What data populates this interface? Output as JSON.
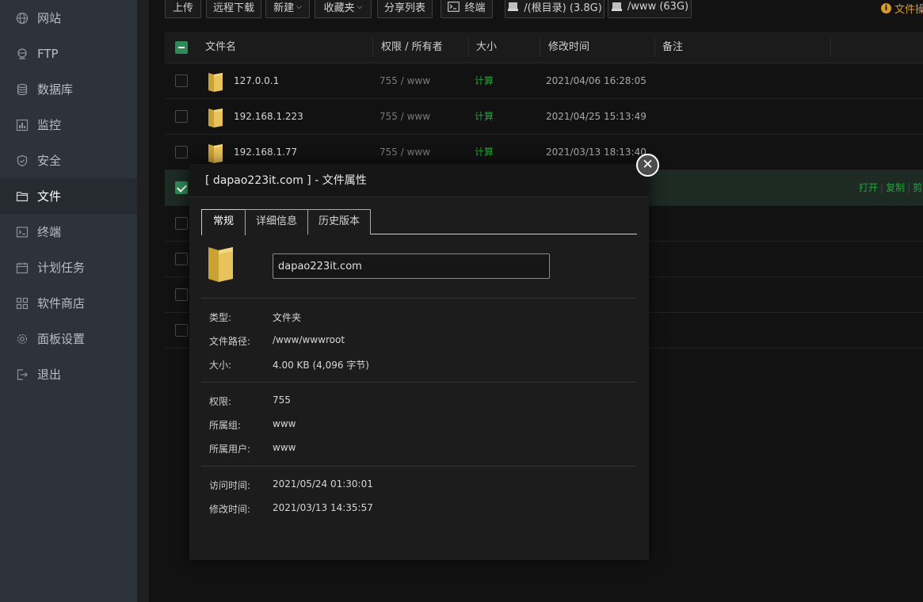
{
  "sidebar": {
    "items": [
      {
        "label": "网站",
        "icon": "globe-icon",
        "active": false
      },
      {
        "label": "FTP",
        "icon": "ftp-icon",
        "active": false
      },
      {
        "label": "数据库",
        "icon": "database-icon",
        "active": false
      },
      {
        "label": "监控",
        "icon": "monitor-icon",
        "active": false
      },
      {
        "label": "安全",
        "icon": "shield-icon",
        "active": false
      },
      {
        "label": "文件",
        "icon": "folder-icon",
        "active": true
      },
      {
        "label": "终端",
        "icon": "terminal-icon",
        "active": false
      },
      {
        "label": "计划任务",
        "icon": "calendar-icon",
        "active": false
      },
      {
        "label": "软件商店",
        "icon": "apps-icon",
        "active": false
      },
      {
        "label": "面板设置",
        "icon": "gear-icon",
        "active": false
      },
      {
        "label": "退出",
        "icon": "logout-icon",
        "active": false
      }
    ]
  },
  "toolbar": {
    "upload": "上传",
    "remote_download": "远程下载",
    "new": "新建",
    "favorites": "收藏夹",
    "share_list": "分享列表",
    "terminal": "终端",
    "disk_root": "/(根目录) (3.8G)",
    "disk_www": "/www (63G)",
    "hint": "文件操"
  },
  "table": {
    "headers": {
      "name": "文件名",
      "perm": "权限 / 所有者",
      "size": "大小",
      "mtime": "修改时间",
      "note": "备注"
    },
    "rows": [
      {
        "name": "127.0.0.1",
        "perm": "755 / www",
        "size": "计算",
        "mtime": "2021/04/06 16:28:05"
      },
      {
        "name": "192.168.1.223",
        "perm": "755 / www",
        "size": "计算",
        "mtime": "2021/04/25 15:13:49"
      },
      {
        "name": "192.168.1.77",
        "perm": "755 / www",
        "size": "计算",
        "mtime": "2021/03/13 18:13:40"
      }
    ],
    "row_actions": {
      "open": "打开",
      "copy": "复制",
      "cut": "剪"
    }
  },
  "dialog": {
    "title": "[ dapao223it.com ] - 文件属性",
    "tabs": [
      "常规",
      "详细信息",
      "历史版本"
    ],
    "name_value": "dapao223it.com",
    "labels": {
      "type": "类型:",
      "path": "文件路径:",
      "size": "大小:",
      "perm": "权限:",
      "group": "所属组:",
      "user": "所属用户:",
      "atime": "访问时间:",
      "mtime": "修改时间:"
    },
    "values": {
      "type": "文件夹",
      "path": "/www/wwwroot",
      "size": "4.00 KB (4,096 字节)",
      "perm": "755",
      "group": "www",
      "user": "www",
      "atime": "2021/05/24 01:30:01",
      "mtime": "2021/03/13 14:35:57"
    }
  },
  "colors": {
    "accent_green": "#20a53a",
    "warning_orange": "#d89b2b",
    "folder_yellow": "#e8c25a"
  }
}
